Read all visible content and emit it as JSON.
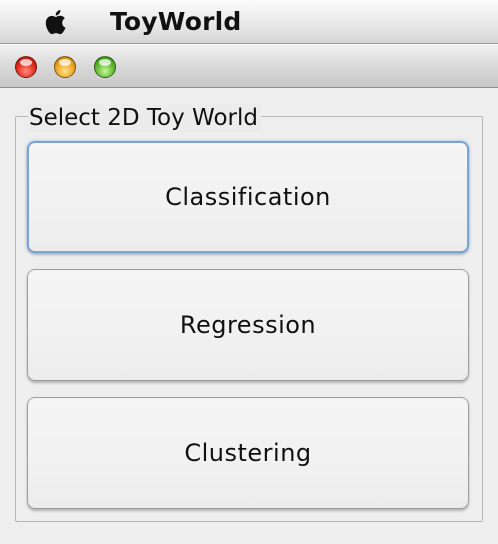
{
  "menubar": {
    "app_name": "ToyWorld",
    "apple_icon": "apple-logo-icon"
  },
  "window": {
    "traffic_lights": {
      "close_color": "#e0281c",
      "minimize_color": "#e8a21c",
      "maximize_color": "#58b52a"
    },
    "group": {
      "title": "Select 2D Toy World",
      "buttons": [
        {
          "label": "Classification",
          "focused": true
        },
        {
          "label": "Regression",
          "focused": false
        },
        {
          "label": "Clustering",
          "focused": false
        }
      ]
    }
  },
  "colors": {
    "focus_ring": "#7aa3d6"
  }
}
